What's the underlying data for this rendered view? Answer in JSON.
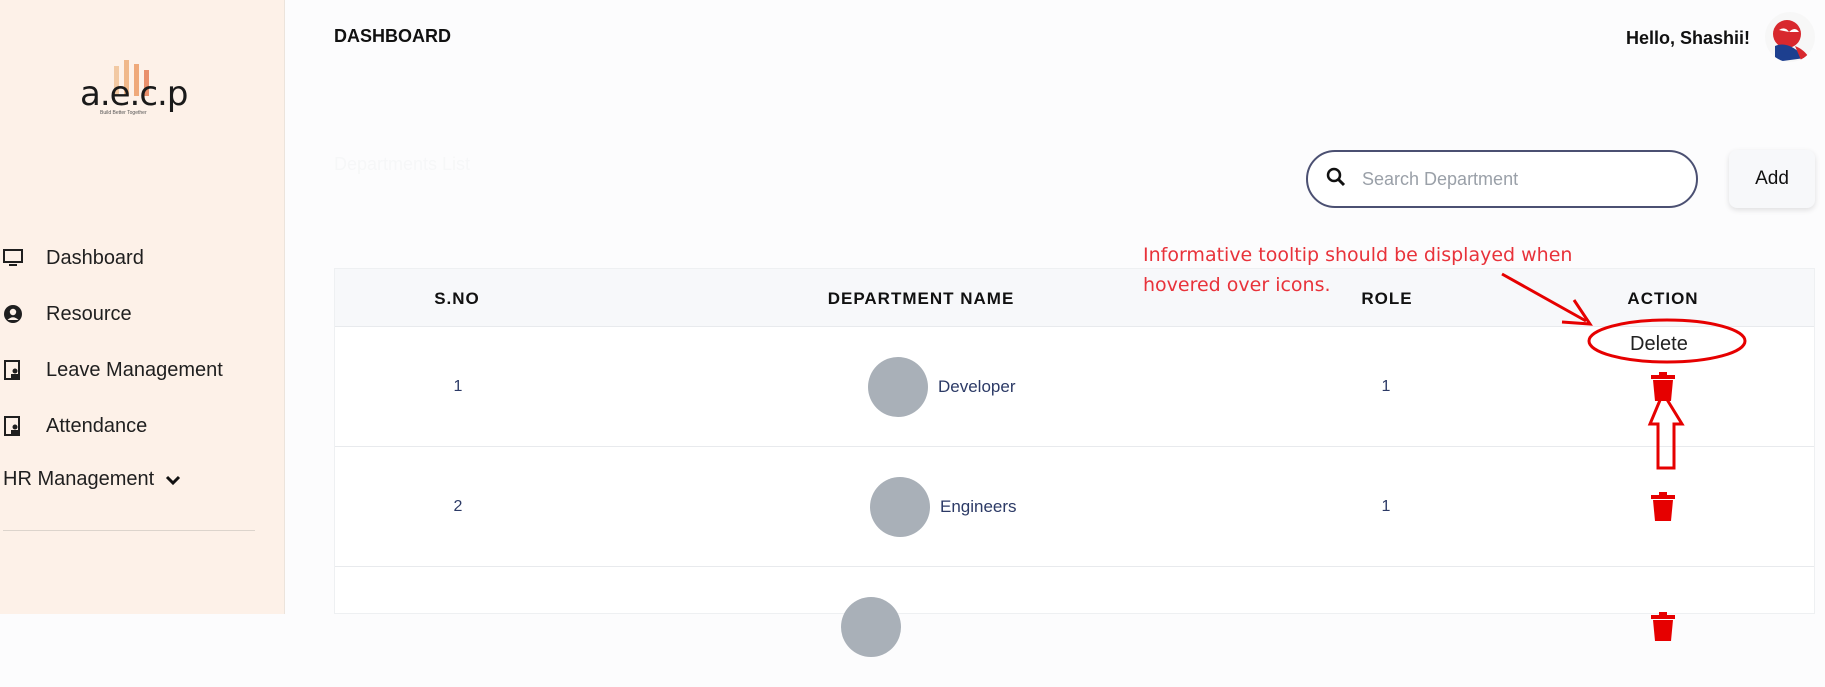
{
  "sidebar": {
    "logo_text": "a.e.c.p",
    "logo_tagline": "Build Better Together",
    "items": [
      {
        "label": "Dashboard",
        "icon": "monitor-icon"
      },
      {
        "label": "Resource",
        "icon": "user-circle-icon"
      },
      {
        "label": "Leave Management",
        "icon": "clipboard-user-icon"
      },
      {
        "label": "Attendance",
        "icon": "clipboard-user-icon"
      }
    ],
    "hr_label": "HR Management"
  },
  "header": {
    "title": "DASHBOARD",
    "greeting": "Hello, Shashii!"
  },
  "main": {
    "section_title": "Departments List",
    "search_placeholder": "Search Department",
    "add_label": "Add"
  },
  "table": {
    "columns": [
      "S.NO",
      "DEPARTMENT NAME",
      "ROLE",
      "ACTION"
    ],
    "rows": [
      {
        "sno": "1",
        "name": "Developer",
        "role": "1"
      },
      {
        "sno": "2",
        "name": "Engineers",
        "role": "1"
      }
    ]
  },
  "annotation": {
    "note": "Informative tooltip should be displayed when hovered over icons.",
    "tooltip": "Delete"
  },
  "colors": {
    "sidebar_bg": "#fdf1e8",
    "accent_red": "#e8323a",
    "trash_red": "#e60000",
    "search_border": "#4b5072"
  }
}
